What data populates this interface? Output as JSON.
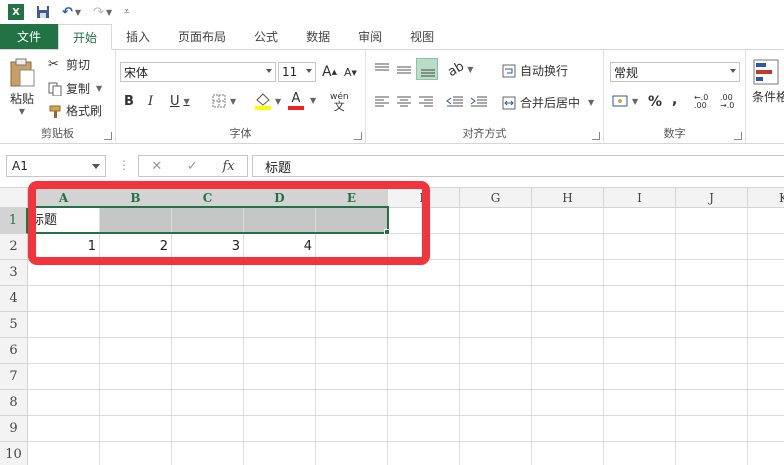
{
  "qat": {
    "logo": "X",
    "undo": "↶",
    "redo": "↷",
    "customize": "⩡"
  },
  "tabs": [
    {
      "label": "文件"
    },
    {
      "label": "开始"
    },
    {
      "label": "插入"
    },
    {
      "label": "页面布局"
    },
    {
      "label": "公式"
    },
    {
      "label": "数据"
    },
    {
      "label": "审阅"
    },
    {
      "label": "视图"
    }
  ],
  "ribbon": {
    "clipboard": {
      "paste": "粘贴",
      "cut": "剪切",
      "copy": "复制",
      "format_painter": "格式刷",
      "label": "剪贴板"
    },
    "font": {
      "name": "宋体",
      "size": "11",
      "grow": "A",
      "shrink": "A",
      "bold": "B",
      "italic": "I",
      "underline": "U",
      "font_color": "A",
      "phonetic": "wén",
      "phonetic_sub": "文",
      "label": "字体"
    },
    "alignment": {
      "wrap_text": "自动换行",
      "merge_center": "合并后居中",
      "label": "对齐方式"
    },
    "number": {
      "format": "常规",
      "percent": "%",
      "comma": ",",
      "inc_decimal": "←.0 .00",
      "dec_decimal": ".00 →.0",
      "label": "数字"
    },
    "styles": {
      "conditional": "条件格"
    }
  },
  "formula_bar": {
    "name_box": "A1",
    "cancel": "✕",
    "enter": "✓",
    "fx": "fx",
    "content": "标题"
  },
  "sheet": {
    "columns": [
      "A",
      "B",
      "C",
      "D",
      "E",
      "F",
      "G",
      "H",
      "I",
      "J",
      "K"
    ],
    "rows": [
      "1",
      "2",
      "3",
      "4",
      "5",
      "6",
      "7",
      "8",
      "9",
      "10"
    ],
    "cells": {
      "A1": "标题",
      "A2": "1",
      "B2": "2",
      "C2": "3",
      "D2": "4"
    }
  },
  "colors": {
    "accent": "#217346",
    "highlight": "#f2353d",
    "selection_fill": "#c6c6c6"
  }
}
